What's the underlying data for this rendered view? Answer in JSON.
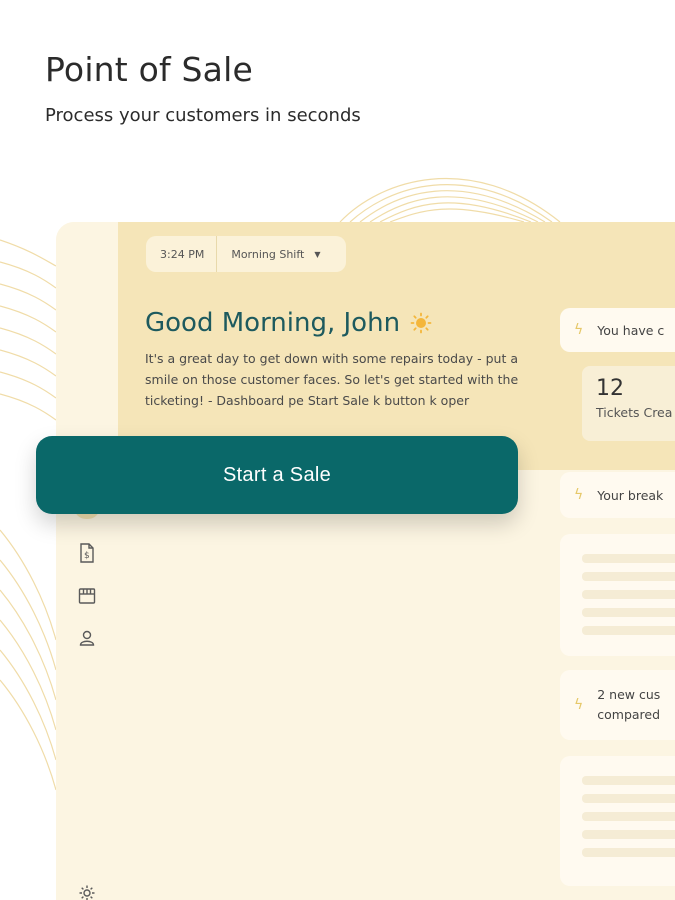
{
  "hero": {
    "title": "Point of Sale",
    "subtitle": "Process your customers in seconds"
  },
  "header": {
    "time": "3:24 PM",
    "shift": "Morning Shift"
  },
  "greeting": {
    "title": "Good Morning, John",
    "body": "It's a great day to get down with some repairs today - put a smile on those customer faces. So let's get started with the ticketing! - Dashboard pe Start Sale k button k oper"
  },
  "cta": {
    "label": "Start a Sale"
  },
  "cards": {
    "notice1": "You have c",
    "stat_number": "12",
    "stat_label": "Tickets Crea",
    "notice2": "Your break",
    "notice3_line1": "2 new cus",
    "notice3_line2": "compared"
  },
  "icons": {
    "sun": "sun-icon",
    "bolt": "lightning-icon",
    "invoice": "invoice-dollar-icon",
    "store": "store-icon",
    "user": "user-icon",
    "settings": "gear-icon",
    "caret": "caret-down-icon"
  },
  "colors": {
    "accent": "#0a6869",
    "header_band": "#f5e5b8",
    "panel": "#fcf5e2",
    "greeting_text": "#1d5a5e",
    "bolt": "#e6c869"
  }
}
